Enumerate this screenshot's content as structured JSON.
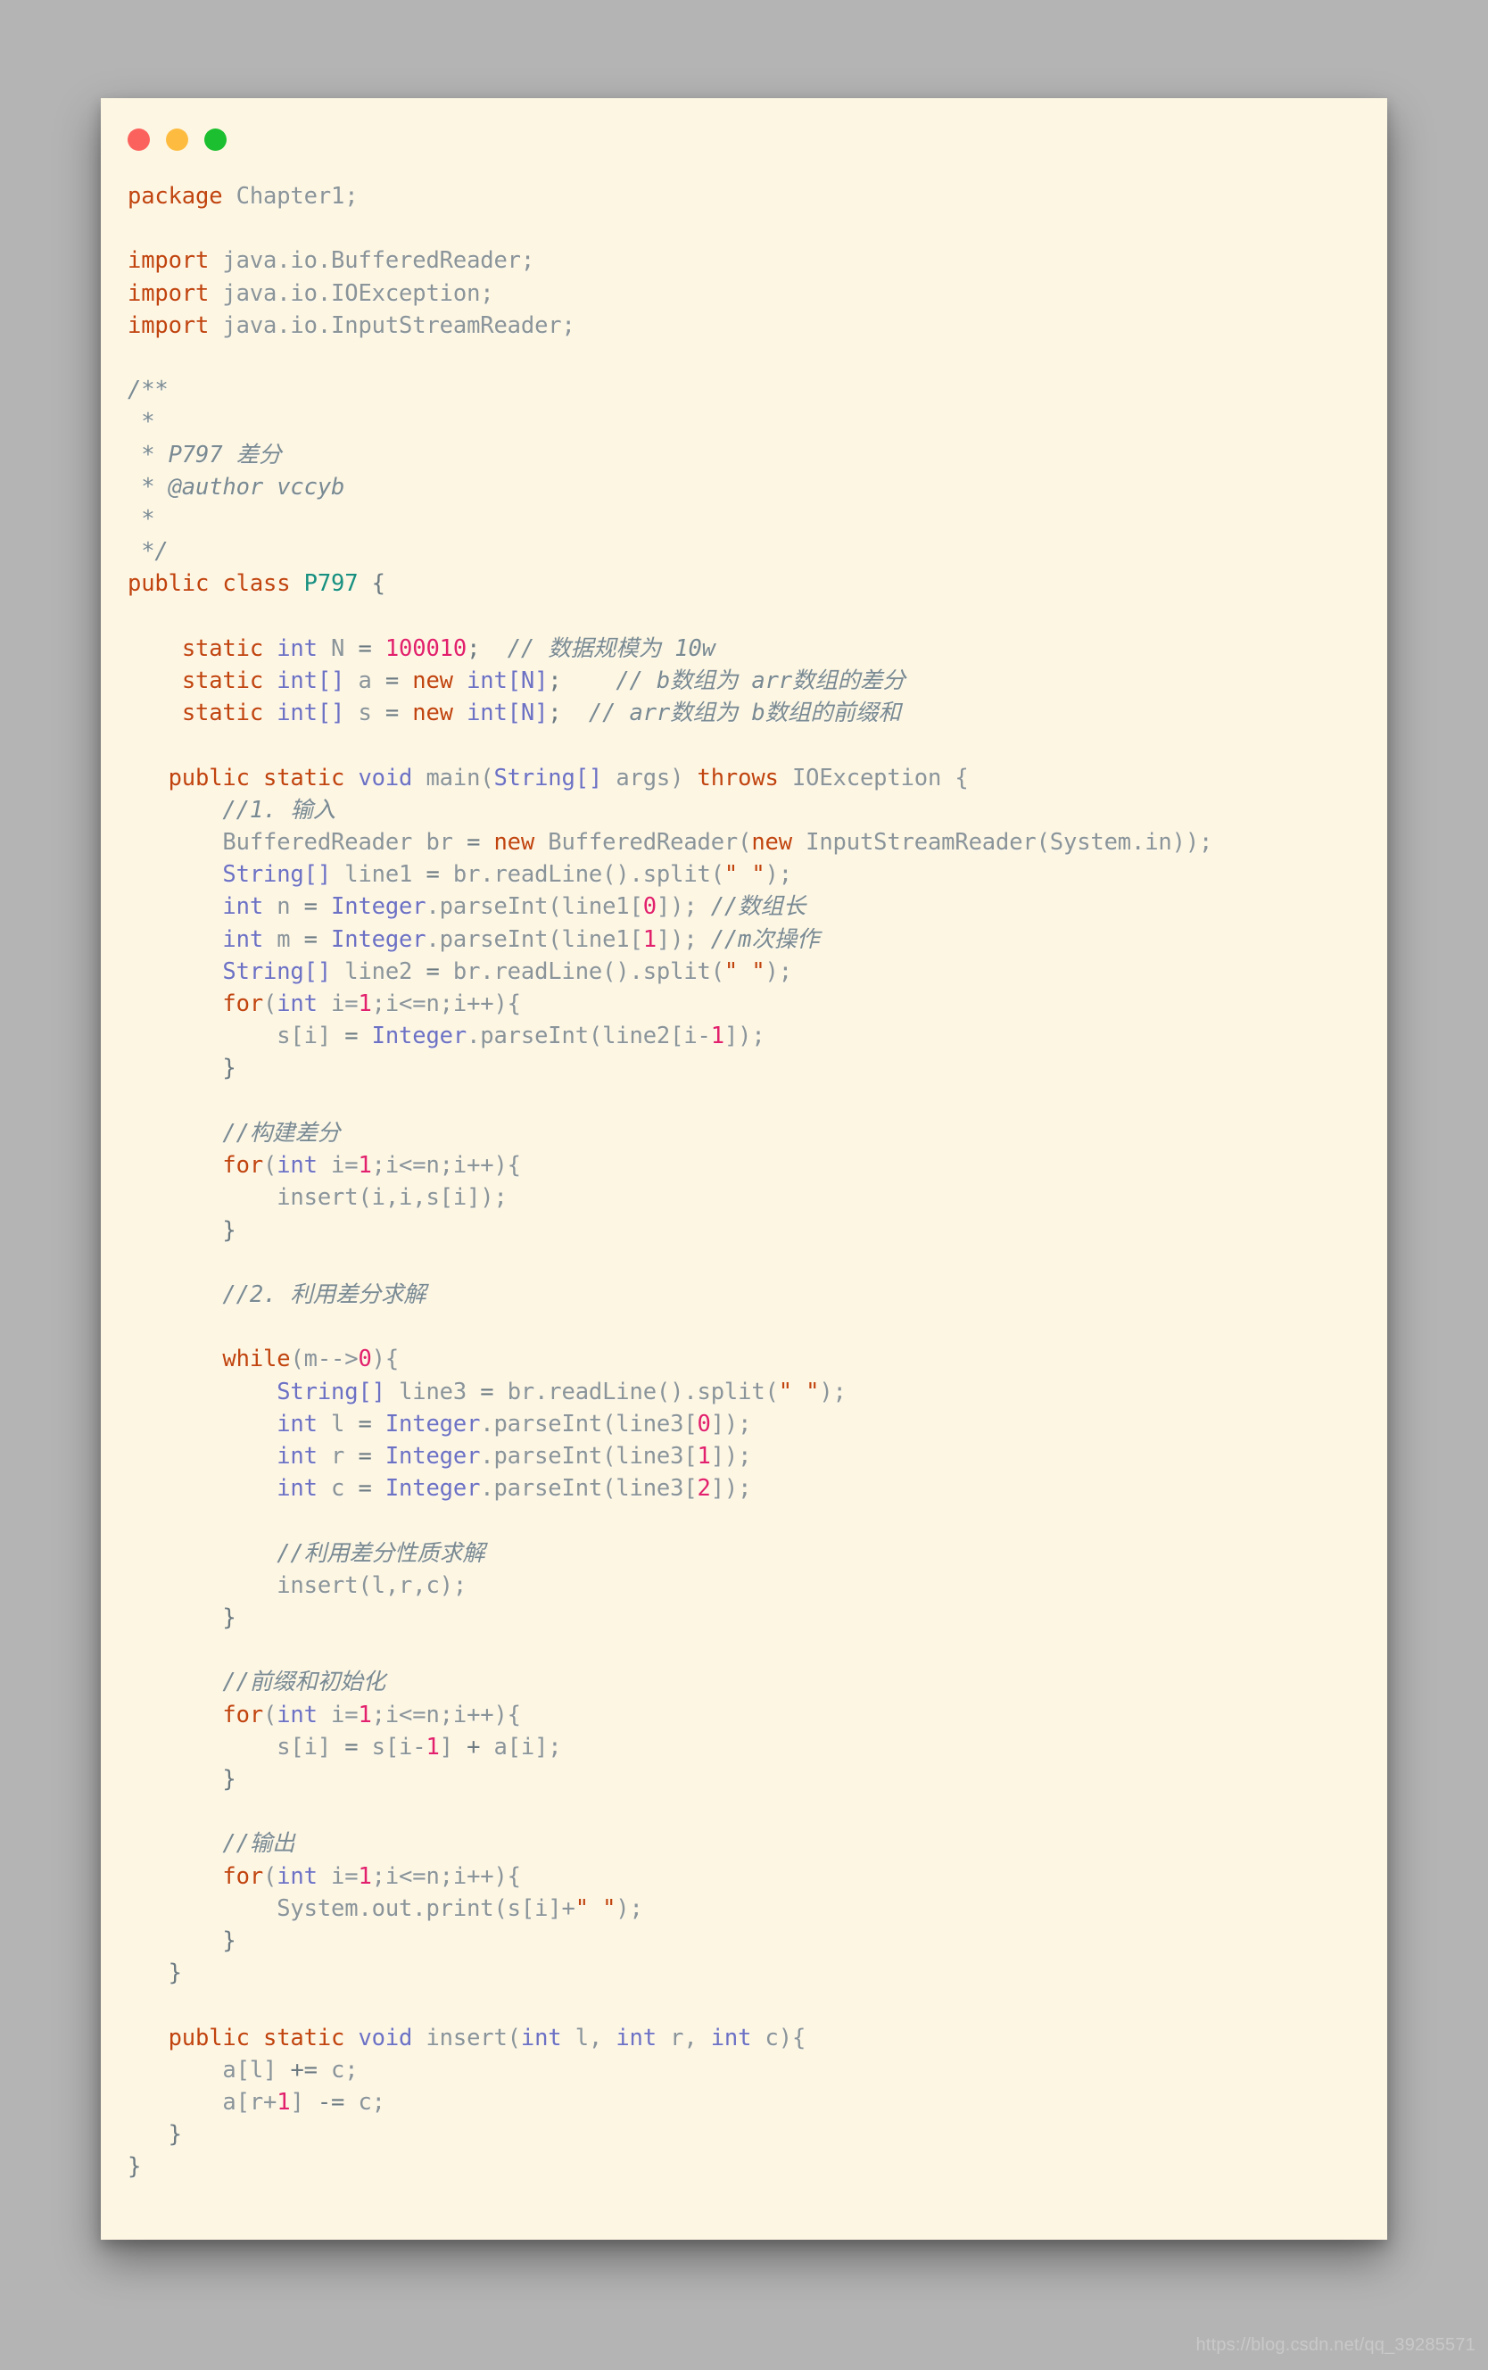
{
  "window": {
    "dots": [
      {
        "name": "close",
        "color": "#fc625d"
      },
      {
        "name": "minimize",
        "color": "#fdbc40"
      },
      {
        "name": "maximize",
        "color": "#1bbf2f"
      }
    ]
  },
  "editor": {
    "language": "java",
    "theme": "solarized-light-cream",
    "background": "#fdf6e3",
    "page_background": "#b4b4b4",
    "colors": {
      "keyword": "#c1440e",
      "type": "#6c71c4",
      "class_name": "#17907f",
      "number": "#e2206b",
      "string": "#c1440e",
      "comment": "#7a8a92",
      "plain": "#8a9499",
      "punctuation": "#6c7a80"
    },
    "code_text": "package Chapter1;\n\nimport java.io.BufferedReader;\nimport java.io.IOException;\nimport java.io.InputStreamReader;\n\n/**\n *\n * P797 差分\n * @author vccyb\n *\n */\npublic class P797 {\n\n    static int N = 100010;  // 数据规模为 10w\n    static int[] a = new int[N];    // b数组为 arr数组的差分\n    static int[] s = new int[N];  // arr数组为 b数组的前缀和\n\n   public static void main(String[] args) throws IOException {\n       //1. 输入\n       BufferedReader br = new BufferedReader(new InputStreamReader(System.in));\n       String[] line1 = br.readLine().split(\" \");\n       int n = Integer.parseInt(line1[0]); //数组长\n       int m = Integer.parseInt(line1[1]); //m次操作\n       String[] line2 = br.readLine().split(\" \");\n       for(int i=1;i<=n;i++){\n           s[i] = Integer.parseInt(line2[i-1]);\n       }\n\n       //构建差分\n       for(int i=1;i<=n;i++){\n           insert(i,i,s[i]);\n       }\n\n       //2. 利用差分求解\n\n       while(m-->0){\n           String[] line3 = br.readLine().split(\" \");\n           int l = Integer.parseInt(line3[0]);\n           int r = Integer.parseInt(line3[1]);\n           int c = Integer.parseInt(line3[2]);\n\n           //利用差分性质求解\n           insert(l,r,c);\n       }\n\n       //前缀和初始化\n       for(int i=1;i<=n;i++){\n           s[i] = s[i-1] + a[i];\n       }\n\n       //输出\n       for(int i=1;i<=n;i++){\n           System.out.print(s[i]+\" \");\n       }\n   }\n\n   public static void insert(int l, int r, int c){\n       a[l] += c;\n       a[r+1] -= c;\n   }\n}",
    "lines": [
      "package Chapter1;",
      "",
      "import java.io.BufferedReader;",
      "import java.io.IOException;",
      "import java.io.InputStreamReader;",
      "",
      "/**",
      " *",
      " * P797 差分",
      " * @author vccyb",
      " *",
      " */",
      "public class P797 {",
      "",
      "    static int N = 100010;  // 数据规模为 10w",
      "    static int[] a = new int[N];    // b数组为 arr数组的差分",
      "    static int[] s = new int[N];  // arr数组为 b数组的前缀和",
      "",
      "   public static void main(String[] args) throws IOException {",
      "       //1. 输入",
      "       BufferedReader br = new BufferedReader(new InputStreamReader(System.in));",
      "       String[] line1 = br.readLine().split(\" \");",
      "       int n = Integer.parseInt(line1[0]); //数组长",
      "       int m = Integer.parseInt(line1[1]); //m次操作",
      "       String[] line2 = br.readLine().split(\" \");",
      "       for(int i=1;i<=n;i++){",
      "           s[i] = Integer.parseInt(line2[i-1]);",
      "       }",
      "",
      "       //构建差分",
      "       for(int i=1;i<=n;i++){",
      "           insert(i,i,s[i]);",
      "       }",
      "",
      "       //2. 利用差分求解",
      "",
      "       while(m-->0){",
      "           String[] line3 = br.readLine().split(\" \");",
      "           int l = Integer.parseInt(line3[0]);",
      "           int r = Integer.parseInt(line3[1]);",
      "           int c = Integer.parseInt(line3[2]);",
      "",
      "           //利用差分性质求解",
      "           insert(l,r,c);",
      "       }",
      "",
      "       //前缀和初始化",
      "       for(int i=1;i<=n;i++){",
      "           s[i] = s[i-1] + a[i];",
      "       }",
      "",
      "       //输出",
      "       for(int i=1;i<=n;i++){",
      "           System.out.print(s[i]+\" \");",
      "       }",
      "   }",
      "",
      "   public static void insert(int l, int r, int c){",
      "       a[l] += c;",
      "       a[r+1] -= c;",
      "   }",
      "}"
    ]
  },
  "watermark": {
    "text": "https://blog.csdn.net/qq_39285571"
  }
}
